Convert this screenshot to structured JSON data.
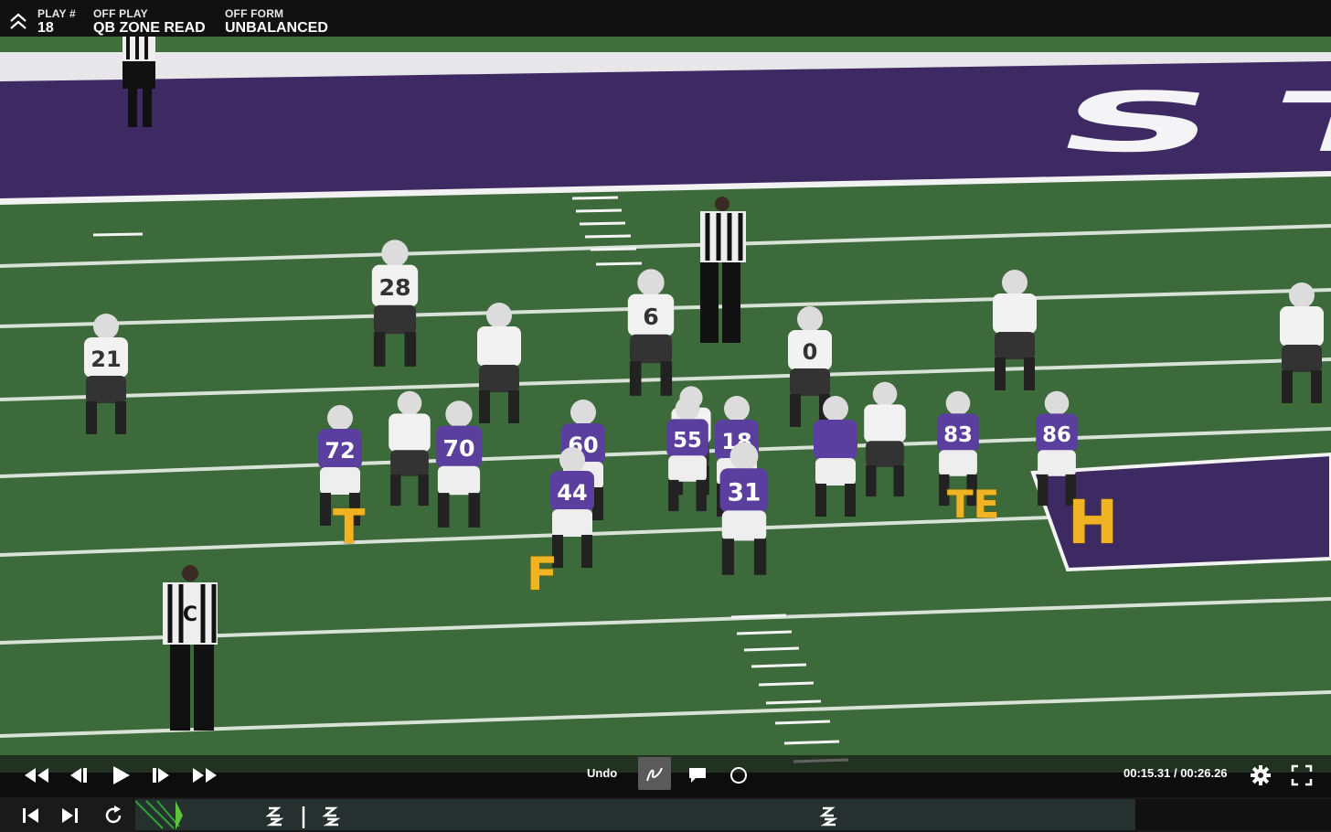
{
  "header": {
    "play_num_label": "PLAY #",
    "play_num": "18",
    "off_play_label": "OFF PLAY",
    "off_play": "QB ZONE READ",
    "off_form_label": "OFF FORM",
    "off_form": "UNBALANCED"
  },
  "field": {
    "endzone_text": "STAT",
    "offense_numbers": [
      "72",
      "70",
      "60",
      "55",
      "18",
      "31",
      "44",
      "83",
      "86"
    ],
    "defense_numbers": [
      "28",
      "21",
      "6",
      "0"
    ],
    "official_badge": "C"
  },
  "annotations": [
    "T",
    "F",
    "TE",
    "H"
  ],
  "controls": {
    "undo_label": "Undo",
    "time_current": "00:15.31",
    "time_total": "00:26.26",
    "time_separator": "/"
  },
  "colors": {
    "annotation": "#f0b323",
    "offense_jersey": "#5a3f9e",
    "defense_jersey": "#f2f2f2",
    "field": "#3d6a3a"
  }
}
